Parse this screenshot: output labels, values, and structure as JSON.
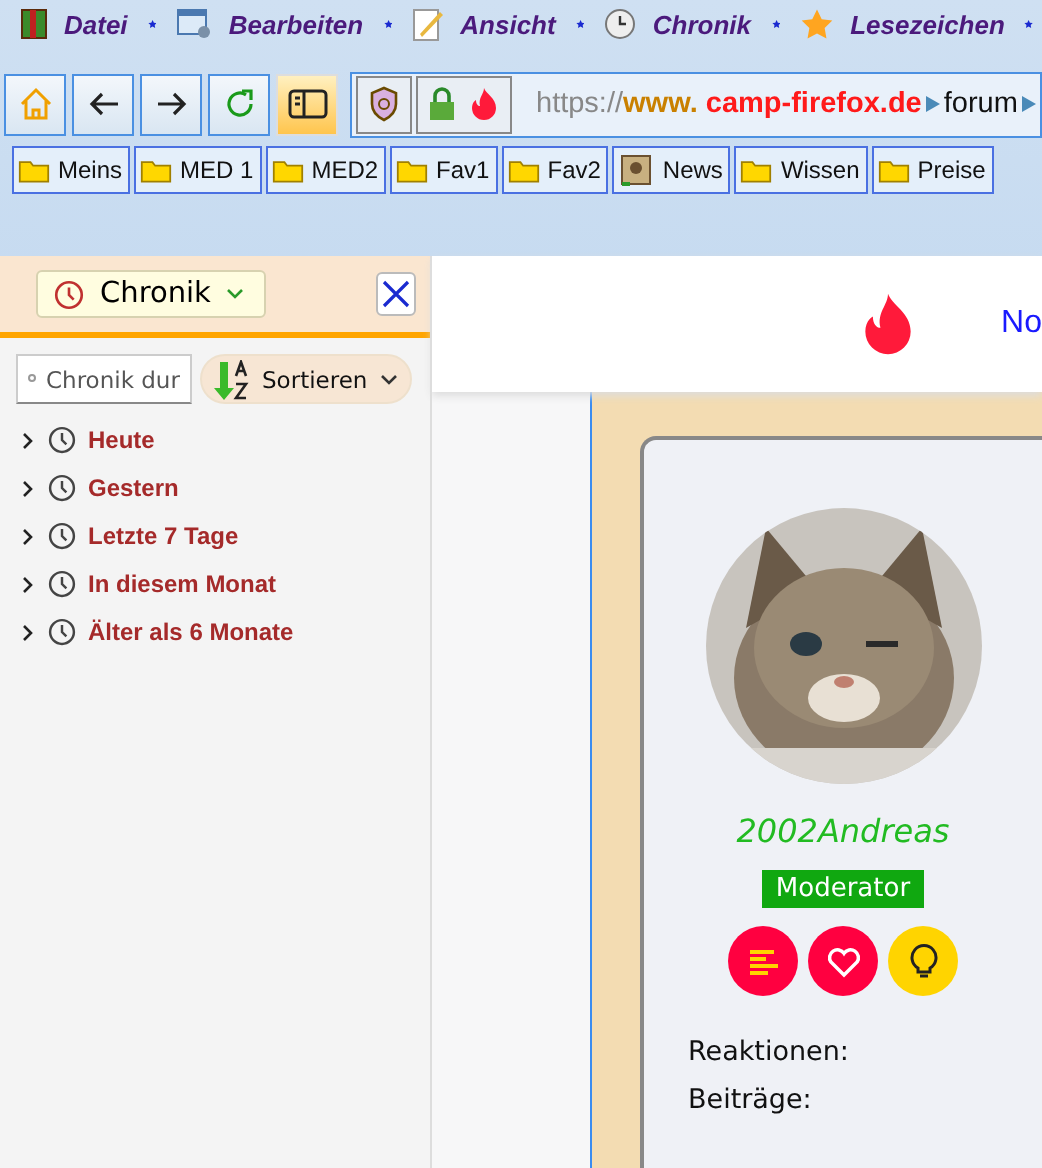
{
  "menu": [
    {
      "label": "Datei",
      "kind": "book"
    },
    {
      "label": "Bearbeiten",
      "kind": "edit"
    },
    {
      "label": "Ansicht",
      "kind": "note"
    },
    {
      "label": "Chronik",
      "kind": "clock"
    },
    {
      "label": "Lesezeichen",
      "kind": "star"
    }
  ],
  "nav": {
    "buttons": [
      {
        "kind": "home"
      },
      {
        "kind": "back"
      },
      {
        "kind": "forward"
      },
      {
        "kind": "reload"
      },
      {
        "kind": "sidebar",
        "selected": true
      }
    ],
    "url": {
      "scheme": "https://",
      "subdomain": "www.",
      "domain": "camp-firefox.de",
      "path": "forum"
    }
  },
  "bookmarks": [
    {
      "label": "Meins",
      "kind": "folder"
    },
    {
      "label": "MED 1",
      "kind": "folder"
    },
    {
      "label": "MED2",
      "kind": "folder"
    },
    {
      "label": "Fav1",
      "kind": "folder"
    },
    {
      "label": "Fav2",
      "kind": "folder"
    },
    {
      "label": "News",
      "kind": "feed"
    },
    {
      "label": "Wissen",
      "kind": "folder"
    },
    {
      "label": "Preise",
      "kind": "folder"
    }
  ],
  "sidebar": {
    "title": "Chronik",
    "search": {
      "placeholder": "Chronik dur"
    },
    "sort": "Sortieren",
    "items": [
      {
        "label": "Heute",
        "expanded": false
      },
      {
        "label": "Gestern",
        "expanded": false
      },
      {
        "label": "Letzte 7 Tage",
        "expanded": false
      },
      {
        "label": "In diesem Monat",
        "expanded": false
      },
      {
        "label": "Älter als 6 Monate",
        "expanded": false
      }
    ]
  },
  "page": {
    "nav_link": "No",
    "profile": {
      "username": "2002Andreas",
      "role": "Moderator",
      "badges": [
        {
          "kind": "list",
          "color": "#ff0040"
        },
        {
          "kind": "heart",
          "color": "#ff0040"
        },
        {
          "kind": "bulb",
          "color": "#ffd400"
        }
      ],
      "stats": [
        {
          "label": "Reaktionen:"
        },
        {
          "label": "Beiträge:"
        }
      ]
    }
  }
}
